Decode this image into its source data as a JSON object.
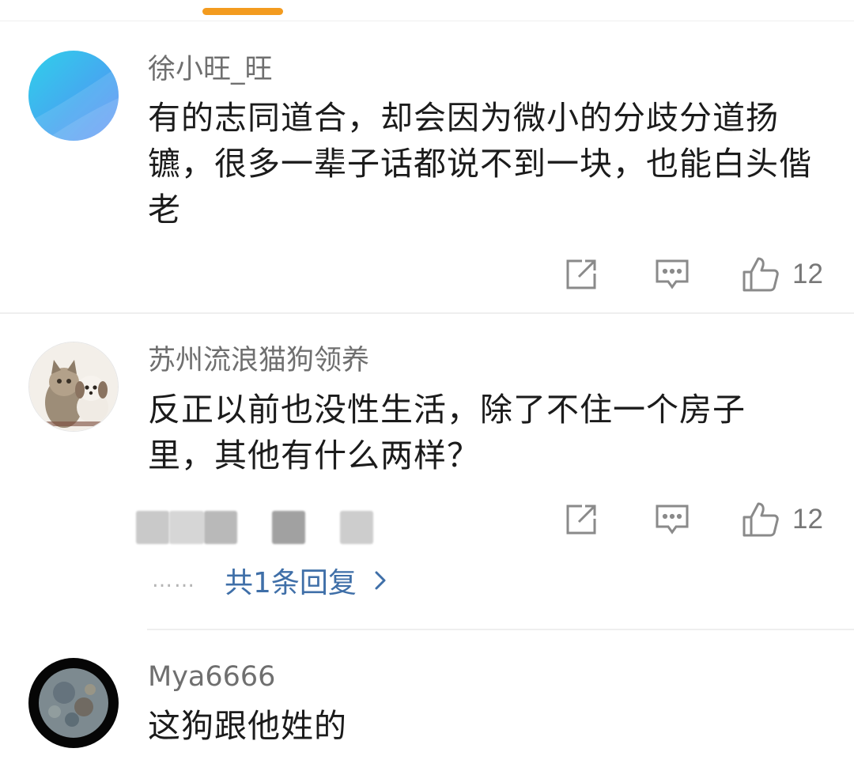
{
  "comments": [
    {
      "username": "徐小旺_旺",
      "text": "有的志同道合，却会因为微小的分歧分道扬镳，很多一辈子话都说不到一块，也能白头偕老",
      "likes": "12",
      "avatar": "blue-gradient-avatar"
    },
    {
      "username": "苏州流浪猫狗领养",
      "text": "反正以前也没性生活，除了不住一个房子里，其他有什么两样？",
      "likes": "12",
      "avatar": "cat-and-dog-avatar",
      "replies_dots": "……",
      "replies_label": "共1条回复"
    },
    {
      "username": "Mya6666",
      "text": "这狗跟他姓的",
      "avatar": "moon-avatar"
    }
  ],
  "colors": {
    "accent": "#f39b1f",
    "link": "#3f6fa8",
    "username": "#6f6f6f"
  }
}
